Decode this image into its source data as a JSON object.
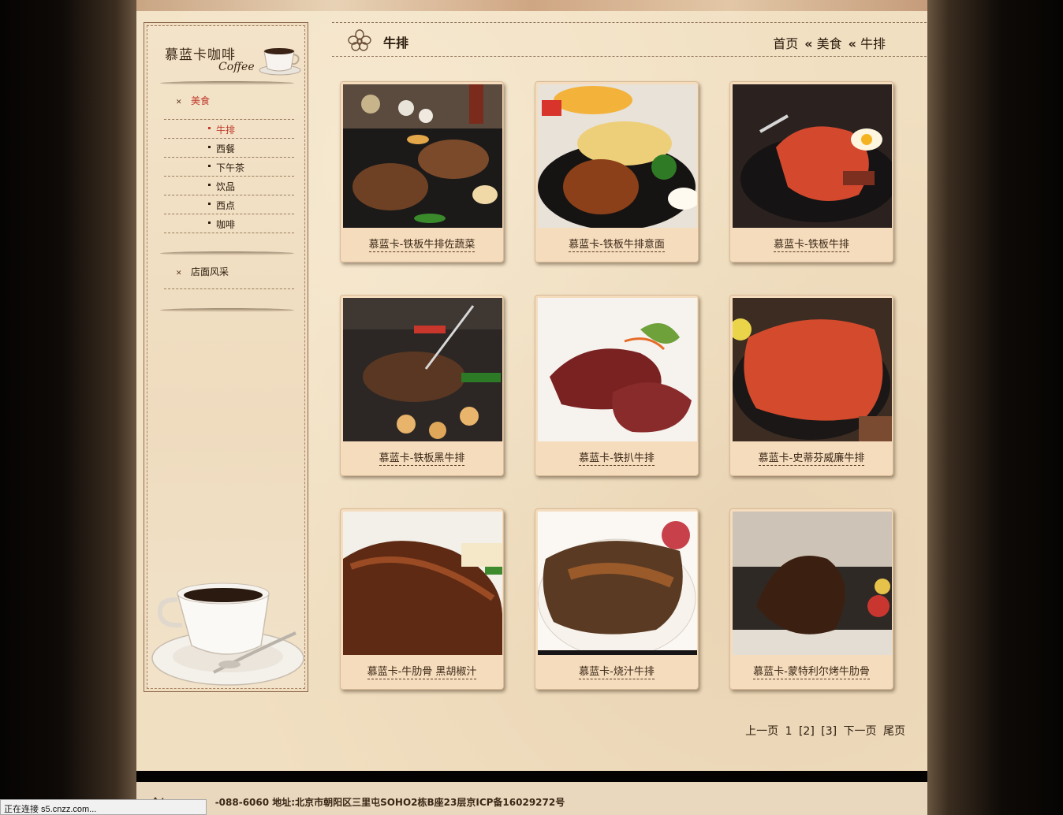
{
  "sidebar": {
    "brand_title": "慕蓝卡咖啡",
    "brand_sub": "Coffee",
    "categories": [
      {
        "label": "美食"
      },
      {
        "label": "店面风采"
      }
    ],
    "sub_items": [
      {
        "label": "牛排"
      },
      {
        "label": "西餐"
      },
      {
        "label": "下午茶"
      },
      {
        "label": "饮品"
      },
      {
        "label": "西点"
      },
      {
        "label": "咖啡"
      }
    ]
  },
  "header": {
    "title": "牛排",
    "breadcrumb": [
      "首页",
      "美食",
      "牛排"
    ],
    "separator": "«"
  },
  "products": [
    {
      "caption": "慕蓝卡-铁板牛排佐蔬菜"
    },
    {
      "caption": "慕蓝卡-铁板牛排意面"
    },
    {
      "caption": "慕蓝卡-铁板牛排"
    },
    {
      "caption": "慕蓝卡-铁板黑牛排"
    },
    {
      "caption": "慕蓝卡-铁扒牛排"
    },
    {
      "caption": "慕蓝卡-史蒂芬威廉牛排"
    },
    {
      "caption": "慕蓝卡-牛肋骨 黑胡椒汁"
    },
    {
      "caption": "慕蓝卡-烧汁牛排"
    },
    {
      "caption": "慕蓝卡-蒙特利尔烤牛肋骨"
    }
  ],
  "pagination": {
    "prev": "上一页",
    "pages": [
      "1",
      "[2]",
      "[3]"
    ],
    "next": "下一页",
    "last": "尾页"
  },
  "footer": {
    "text": "全("
  },
  "footer_line": "-088-6060  地址:北京市朝阳区三里屯SOHO2栋B座23层京ICP备16029272号",
  "status_bar": "正在连接 s5.cnzz.com..."
}
